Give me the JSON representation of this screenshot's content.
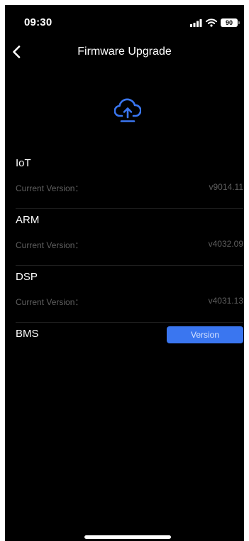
{
  "status_bar": {
    "time": "09:30",
    "battery": "90",
    "icons": [
      "cellular-signal-icon",
      "wifi-icon",
      "battery-icon"
    ]
  },
  "nav": {
    "title": "Firmware Upgrade",
    "back_icon": "chevron-left-icon"
  },
  "header_icon": "cloud-upload-icon",
  "firmware": [
    {
      "name": "IoT",
      "label": "Current Version：",
      "version": "v9014.11"
    },
    {
      "name": "ARM",
      "label": "Current Version：",
      "version": "v4032.09"
    },
    {
      "name": "DSP",
      "label": "Current Version：",
      "version": "v4031.13"
    }
  ],
  "bms": {
    "name": "BMS",
    "button_label": "Version"
  },
  "colors": {
    "background": "#000000",
    "accent": "#3a76f0",
    "muted_text": "#5f5f5f",
    "divider": "#1e1e1e"
  }
}
